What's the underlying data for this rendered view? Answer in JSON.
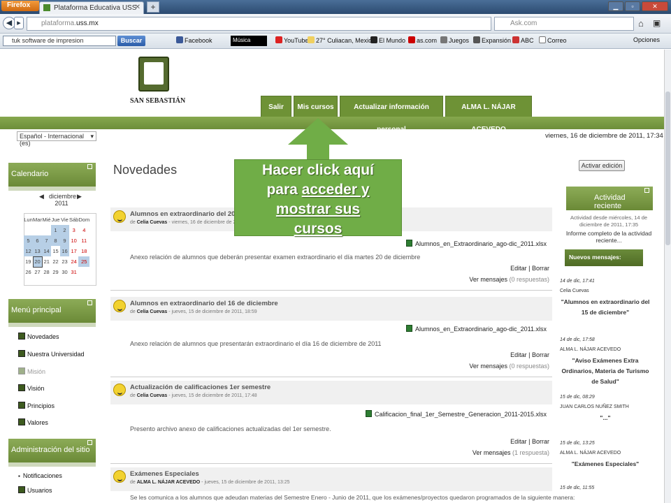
{
  "browser": {
    "app_button": "Firefox",
    "tab_title": "Plataforma Educativa USS",
    "new_tab": "+",
    "url_prefix": "plataforma.",
    "url_domain": "uss.mx",
    "search_engine_placeholder": "Ask.com",
    "toolbar_search_value": "tuk software de impresion",
    "buscar": "Buscar",
    "toolbar_items": [
      "Facebook",
      "Música",
      "YouTube",
      "27° Culiacan, Mexico",
      "El Mundo",
      "as.com",
      "Juegos",
      "Expansión",
      "ABC",
      "Correo"
    ],
    "opciones": "Opciones"
  },
  "site": {
    "logo_text": "SAN SEBASTIÁN",
    "nav": [
      "Salir",
      "Mis cursos",
      "Actualizar información personal",
      "ALMA L. NÁJAR ACEVEDO"
    ],
    "language": "Español - Internacional (es)",
    "date": "viernes, 16 de diciembre de 2011, 17:34",
    "edit_button": "Activar edición",
    "page_title": "Novedades"
  },
  "calendar": {
    "header": "Calendario",
    "month": "diciembre",
    "year": "2011",
    "days": [
      "Lun",
      "Mar",
      "Mié",
      "Jue",
      "Vie",
      "Sáb",
      "Dom"
    ],
    "weeks": [
      [
        "",
        "",
        "",
        "1",
        "2",
        "3",
        "4"
      ],
      [
        "5",
        "6",
        "7",
        "8",
        "9",
        "10",
        "11"
      ],
      [
        "12",
        "13",
        "14",
        "15",
        "16",
        "17",
        "18"
      ],
      [
        "19",
        "20",
        "21",
        "22",
        "23",
        "24",
        "25"
      ],
      [
        "26",
        "27",
        "28",
        "29",
        "30",
        "31",
        ""
      ]
    ]
  },
  "menu_principal": {
    "header": "Menú principal",
    "items": [
      "Novedades",
      "Nuestra Universidad",
      "Misión",
      "Visión",
      "Principios",
      "Valores"
    ]
  },
  "admin": {
    "header": "Administración del sitio",
    "items": [
      "Notificaciones",
      "Usuarios"
    ]
  },
  "posts": [
    {
      "title": "Alumnos en extraordinario del 20 de diciembre",
      "meta_pre": "de",
      "author": "Celia Cuevas",
      "date": " - viernes, 16 de diciembre de 2011, 10:",
      "attachment": "Alumnos_en_Extraordinario_ago-dic_2011.xlsx",
      "body": "Anexo relación de alumnos que deberán presentar examen extraordinario el día martes 20 de diciembre",
      "actions": "Editar | Borrar",
      "replies_label": "Ver mensajes",
      "replies_count": "(0 respuestas)"
    },
    {
      "title": "Alumnos en extraordinario del 16 de diciembre",
      "meta_pre": "de",
      "author": "Celia Cuevas",
      "date": " - jueves, 15 de diciembre de 2011, 18:59",
      "attachment": "Alumnos_en_Extraordinario_ago-dic_2011.xlsx",
      "body": "Anexo relación de alumnos que presentarán extraordinario el día 16 de diciembre de 2011",
      "actions": "Editar | Borrar",
      "replies_label": "Ver mensajes",
      "replies_count": "(0 respuestas)"
    },
    {
      "title": "Actualización de calificaciones 1er semestre",
      "meta_pre": "de",
      "author": "Celia Cuevas",
      "date": " - jueves, 15 de diciembre de 2011, 17:48",
      "attachment": "Calificacion_final_1er_Semestre_Generacion_2011-2015.xlsx",
      "body": "Presento archivo anexo de calificaciones actualizadas del 1er semestre.",
      "actions": "Editar | Borrar",
      "replies_label": "Ver mensajes",
      "replies_count": "(1 respuesta)"
    },
    {
      "title": "Exámenes Especiales",
      "meta_pre": "de",
      "author": "ALMA L. NÁJAR ACEVEDO",
      "date": " - jueves, 15 de diciembre de 2011, 13:25",
      "body": "Se les comunica a los alumnos que adeudan materias del Semestre Enero - Junio de 2011, que los exámenes/proyectos quedaron programados de la siguiente manera:"
    }
  ],
  "recent": {
    "header": "Actividad reciente",
    "since": "Actividad desde miércoles, 14 de diciembre de 2011, 17:35",
    "full_report": "Informe completo de la actividad reciente...",
    "new_messages": "Nuevos mensajes:",
    "items": [
      {
        "date": "14 de dic, 17:41",
        "name": "Celia Cuevas",
        "text": "\"Alumnos en extraordinario del 15 de diciembre\""
      },
      {
        "date": "14 de dic, 17:58",
        "name": "ALMA L. NÁJAR ACEVEDO",
        "text": "\"Aviso Exámenes Extra Ordinarios, Materia de Turismo de Salud\""
      },
      {
        "date": "15 de dic, 08:29",
        "name": "JUAN CARLOS NUÑEZ SMITH",
        "text": "\"...\""
      },
      {
        "date": "15 de dic, 13:25",
        "name": "ALMA L. NÁJAR ACEVEDO",
        "text": "\"Exámenes Especiales\""
      },
      {
        "date": "15 de dic, 11:55",
        "name": "",
        "text": ""
      }
    ]
  },
  "callout": {
    "line1": "Hacer click aquí",
    "line2_a": "para ",
    "line2_b": "acceder y",
    "line3": "mostrar sus",
    "line4": "cursos"
  }
}
